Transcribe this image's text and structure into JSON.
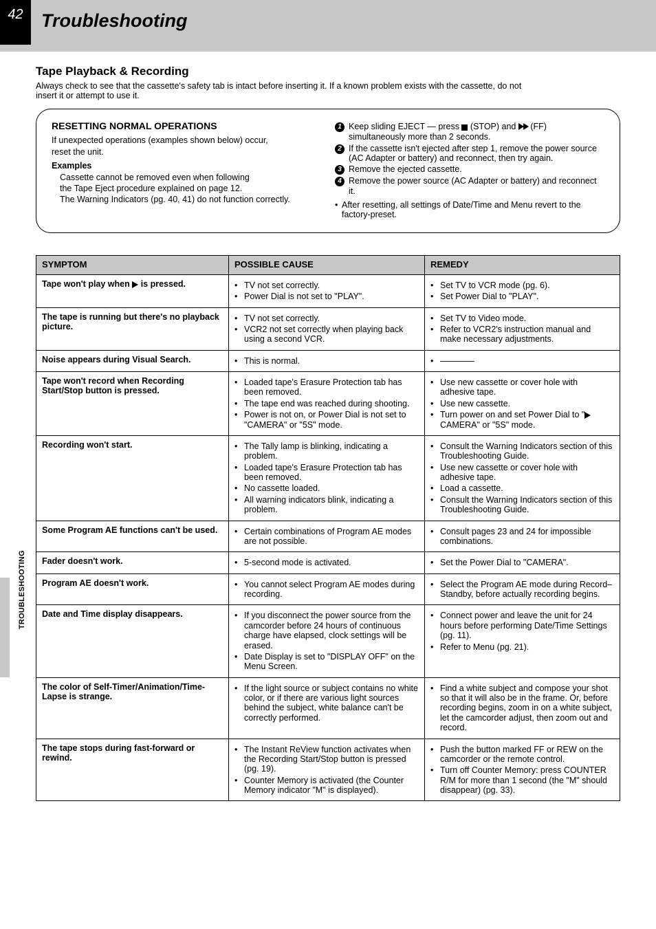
{
  "header": {
    "page_number": "42",
    "title": "Troubleshooting"
  },
  "side_tab_label": "TROUBLESHOOTING",
  "tape_section": {
    "title": "Tape Playback & Recording",
    "lead": "Always check to see that the cassette's safety tab is intact before inserting it. If a known problem exists with the cassette, do not insert it or attempt to use it."
  },
  "reset": {
    "heading": "RESETTING NORMAL OPERATIONS",
    "intro_line1": "If unexpected operations (examples shown below) occur,",
    "intro_line2": "reset the unit.",
    "examples_heading": "Examples",
    "example1": "Cassette cannot be removed even when following",
    "example1_cont": "the Tape Eject procedure explained on page 12.",
    "example2": "The Warning Indicators (pg. 40, 41) do not function correctly.",
    "step1_a": "Keep sliding EJECT — press ",
    "step1_b": " (STOP) and ",
    "step1_c": " (FF) simultaneously more than 2 seconds.",
    "step2": "If the cassette isn't ejected after step 1, remove the power source (AC Adapter or battery) and reconnect, then try again.",
    "step3": "Remove the ejected cassette.",
    "step4": "Remove the power source (AC Adapter or battery) and reconnect it.",
    "after_bullet": "After resetting, all settings of Date/Time and Menu revert to the factory-preset."
  },
  "table": {
    "headers": {
      "symptom": "SYMPTOM",
      "cause": "POSSIBLE CAUSE",
      "remedy": "REMEDY"
    },
    "rows": [
      {
        "symptom_a": "Tape won't play when ",
        "symptom_b": " is pressed.",
        "causes": [
          "TV not set correctly.",
          "Power Dial is not set to \"PLAY\"."
        ],
        "remedies": [
          "Set TV to VCR mode (pg. 6).",
          "Set Power Dial to \"PLAY\"."
        ],
        "remedy_play_icon_index": 0
      },
      {
        "symptom": "The tape is running but there's no playback picture.",
        "causes": [
          "TV not set correctly.",
          "VCR2 not set correctly when playing back using a second VCR."
        ],
        "remedies": [
          "Set TV to Video mode.",
          "Refer to VCR2's instruction manual and make necessary adjustments."
        ]
      },
      {
        "symptom": "Noise appears during Visual Search.",
        "causes": [
          "This is normal."
        ],
        "remedies": [
          "————"
        ]
      },
      {
        "symptom": "Tape won't record when Recording Start/Stop button is pressed.",
        "causes": [
          "Loaded tape's Erasure Protection tab has been removed.",
          "The tape end was reached during shooting.",
          "Power is not on, or Power Dial is not set to \"CAMERA\" or \"5S\" mode."
        ],
        "remedies": [
          "Use new cassette or cover hole with adhesive tape.",
          "Use new cassette.",
          "Turn power on and set Power Dial to \"CAMERA\" or \"5S\" mode."
        ],
        "remedy_play_icon_index": 2
      },
      {
        "symptom": "Recording won't start.",
        "causes": [
          "The Tally lamp is blinking, indicating a problem.",
          "Loaded tape's Erasure Protection tab has been removed.",
          "No cassette loaded.",
          "All warning indicators blink, indicating a problem."
        ],
        "remedies": [
          "Consult the Warning Indicators section of this Troubleshooting Guide.",
          "Use new cassette or cover hole with adhesive tape.",
          "Load a cassette.",
          "Consult the Warning Indicators section of this Troubleshooting Guide."
        ]
      },
      {
        "symptom": "Some Program AE functions can't be used.",
        "causes": [
          "Certain combinations of Program AE modes are not possible."
        ],
        "remedies": [
          "Consult pages 23 and 24 for impossible combinations."
        ]
      },
      {
        "symptom": "Fader doesn't work.",
        "causes": [
          "5-second mode is activated."
        ],
        "remedies": [
          "Set the Power Dial to \"CAMERA\"."
        ]
      },
      {
        "symptom": "Program AE doesn't work.",
        "causes": [
          "You cannot select Program AE modes during recording."
        ],
        "remedies": [
          "Select the Program AE mode during Record–Standby, before actually recording begins."
        ]
      },
      {
        "symptom": "Date and Time display disappears.",
        "causes": [
          "If you disconnect the power source from the camcorder before 24 hours of continuous charge have elapsed, clock settings will be erased.",
          "Date Display is set to \"DISPLAY OFF\" on the Menu Screen."
        ],
        "remedies": [
          "Connect power and leave the unit for 24 hours before performing Date/Time Settings (pg. 11).",
          "Refer to Menu (pg. 21)."
        ]
      },
      {
        "symptom": "The color of Self-Timer/Animation/Time-Lapse is strange.",
        "causes": [
          "If the light source or subject contains no white color, or if there are various light sources behind the subject, white balance can't be correctly performed."
        ],
        "remedies": [
          "Find a white subject and compose your shot so that it will also be in the frame. Or, before recording begins, zoom in on a white subject, let the camcorder adjust, then zoom out and record."
        ]
      },
      {
        "symptom": "The tape stops during fast-forward or rewind.",
        "causes": [
          "The Instant ReView function activates when the Recording Start/Stop button is pressed (pg. 19).",
          "Counter Memory is activated (the Counter Memory indicator \"M\" is displayed)."
        ],
        "remedies": [
          "Push the button marked FF or REW on the camcorder or the remote control.",
          "Turn off Counter Memory: press COUNTER R/M for more than 1 second (the \"M\" should disappear) (pg. 33)."
        ]
      }
    ]
  }
}
